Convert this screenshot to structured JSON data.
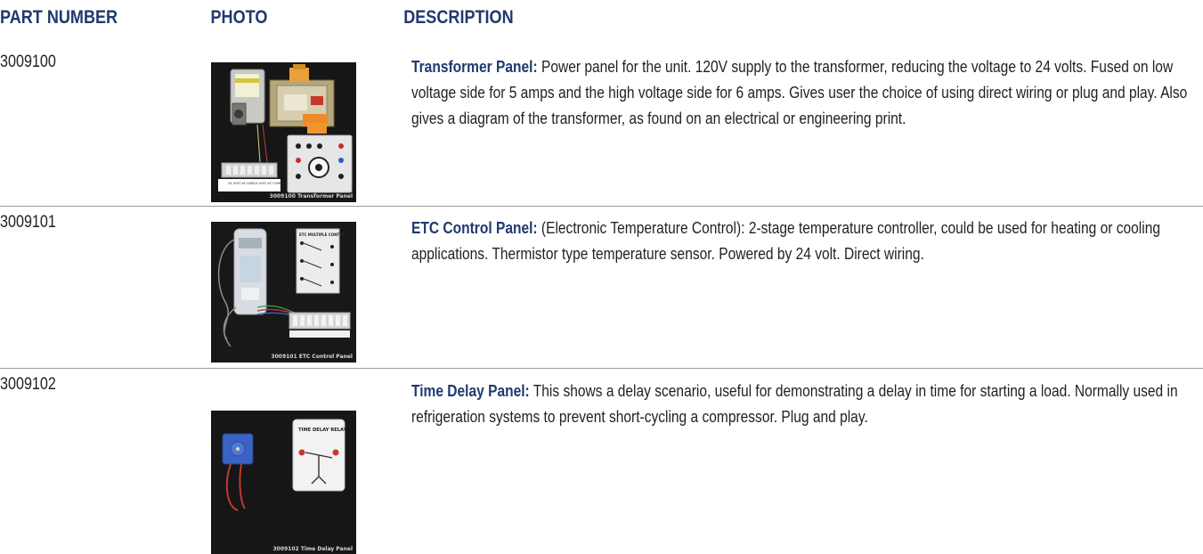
{
  "headers": {
    "part_number": "PART NUMBER",
    "photo": "PHOTO",
    "description": "DESCRIPTION"
  },
  "rows": [
    {
      "part_number": "3009100",
      "title": "Transformer Panel:",
      "description": "Power panel for the unit. 120V supply to the transformer, reducing the voltage to 24 volts. Fused on low voltage side for 5 amps and the high voltage side for 6 amps. Gives user the choice of using direct wiring or plug and play. Also gives a diagram of the transformer, as found on an electrical or engineering print.",
      "photo_caption": "3009100  Transformer Panel",
      "photo_labels": {
        "line": "24 VOLT AC LINE",
        "common": "24 VOLT AC COMMON"
      }
    },
    {
      "part_number": "3009101",
      "title": "ETC Control Panel:",
      "description": "(Electronic Temperature Control): 2-stage temperature controller, could be used for heating or cooling applications. Thermistor type temperature sensor. Powered by 24 volt. Direct wiring.",
      "photo_caption": "3009101  ETC Control Panel",
      "photo_labels": {
        "card": "ETC MULTIPLE CONTROL"
      }
    },
    {
      "part_number": "3009102",
      "title": "Time Delay Panel:",
      "description": "This shows a delay scenario, useful for demonstrating a delay in time for starting a load. Normally used in refrigeration systems to prevent short-cycling a compressor. Plug and play.",
      "photo_caption": "3009102  Time Delay Panel",
      "photo_labels": {
        "card": "TIME DELAY RELAY"
      }
    }
  ],
  "colors": {
    "heading": "#1f3a6e",
    "text": "#231f20",
    "divider": "#9a9a9a",
    "photo_background": "#141414"
  }
}
